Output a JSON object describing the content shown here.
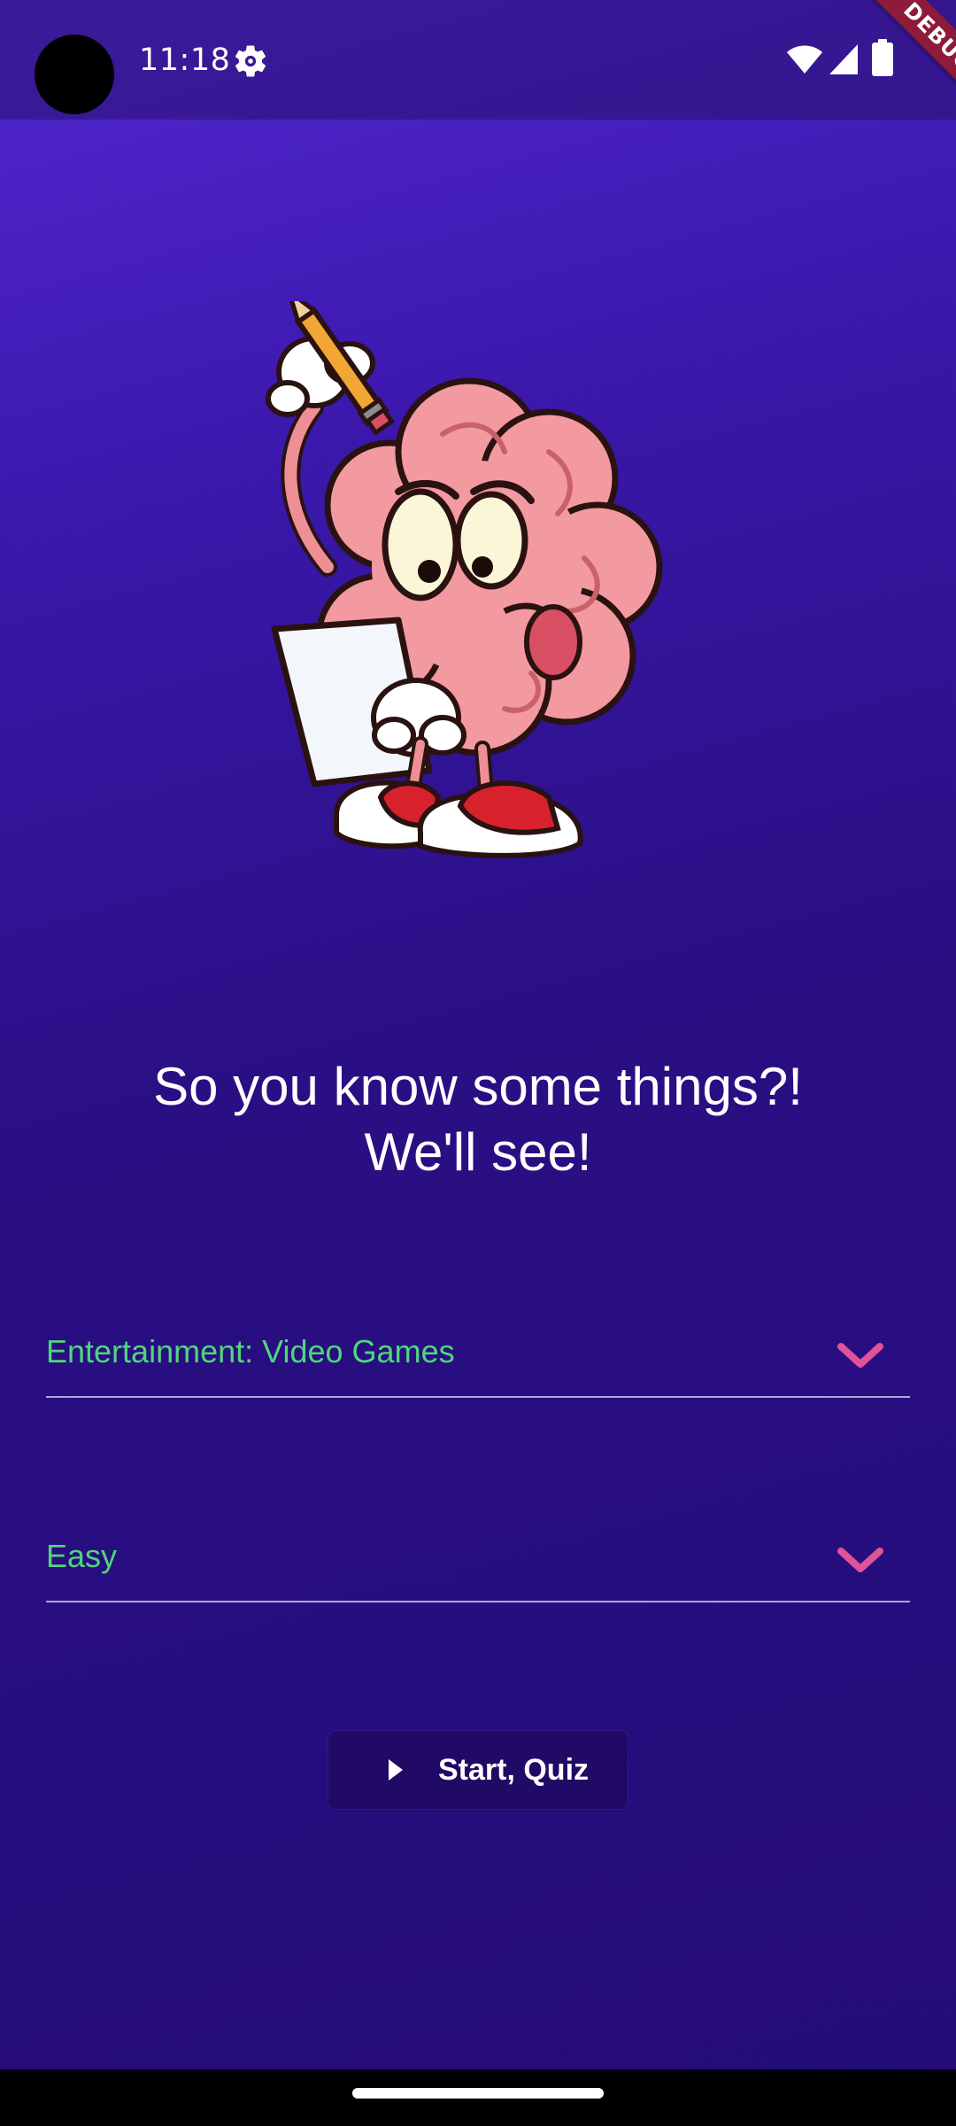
{
  "status_bar": {
    "time": "11:18",
    "icons": [
      "camera-cutout",
      "settings-icon",
      "wifi-icon",
      "signal-icon",
      "battery-icon"
    ]
  },
  "debug_banner": "DEBUG",
  "illustration": {
    "icon": "brain-mascot-with-pencil"
  },
  "tagline": {
    "line1": "So you know some things?!",
    "line2": "We'll see!"
  },
  "category_dropdown": {
    "selected": "Entertainment: Video Games"
  },
  "difficulty_dropdown": {
    "selected": "Easy"
  },
  "start_button": {
    "label": "Start, Quiz",
    "icon": "play-icon"
  },
  "colors": {
    "background_top": "#5328d2",
    "background_bottom": "#240c78",
    "dropdown_text": "#4fd67c",
    "chevron": "#e0529a",
    "button_bg": "#200a66",
    "debug_ribbon": "#8e1b3a"
  }
}
